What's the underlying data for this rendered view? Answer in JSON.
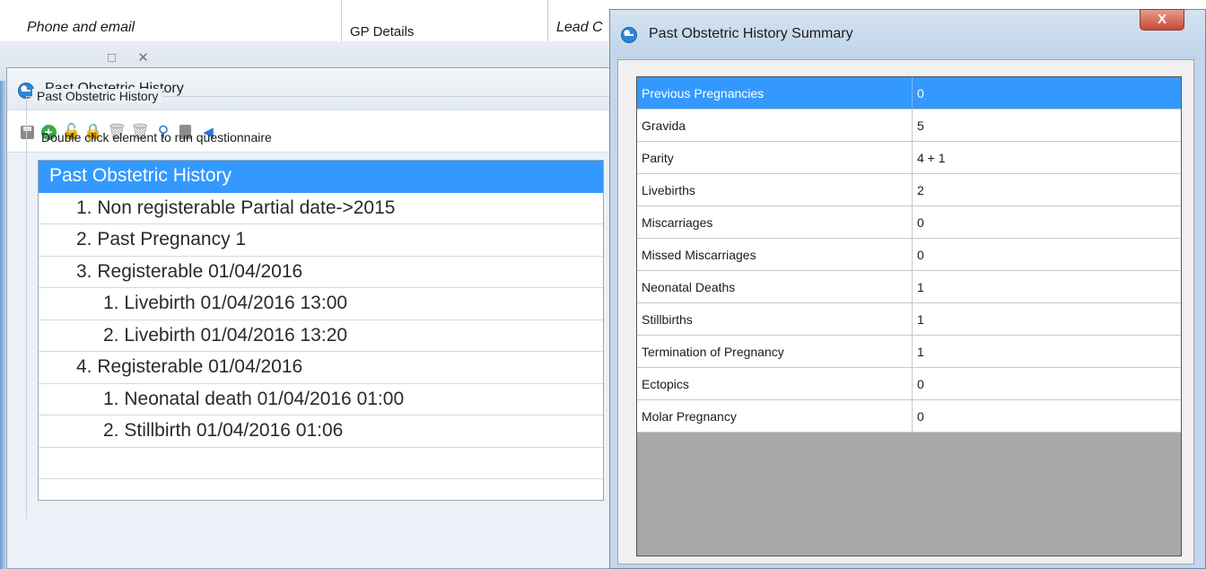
{
  "background": {
    "columns": [
      "Phone and email",
      "GP Details",
      "Lead C"
    ],
    "window_buttons": "□ ✕"
  },
  "obstetric_window": {
    "title": "Past Obstetric History",
    "toolbar": [
      "save-icon",
      "add-icon",
      "unlock-icon",
      "lock-icon",
      "delete-icon",
      "delete-all-icon",
      "zoom-out-icon",
      "calculator-icon",
      "back-arrow-icon"
    ],
    "group_label": "Past Obstetric History",
    "hint": "Double click element to run questionnaire",
    "tree": [
      {
        "label": "Past Obstetric History",
        "level": 0,
        "selected": true
      },
      {
        "label": "1. Non registerable Partial date->2015",
        "level": 1,
        "selected": false
      },
      {
        "label": "2. Past Pregnancy 1",
        "level": 1,
        "selected": false
      },
      {
        "label": "3. Registerable 01/04/2016",
        "level": 1,
        "selected": false
      },
      {
        "label": "1. Livebirth 01/04/2016 13:00",
        "level": 2,
        "selected": false
      },
      {
        "label": "2. Livebirth 01/04/2016 13:20",
        "level": 2,
        "selected": false
      },
      {
        "label": "4. Registerable 01/04/2016",
        "level": 1,
        "selected": false
      },
      {
        "label": "1. Neonatal death 01/04/2016 01:00",
        "level": 2,
        "selected": false
      },
      {
        "label": "2. Stillbirth 01/04/2016 01:06",
        "level": 2,
        "selected": false
      },
      {
        "label": "",
        "level": 0,
        "selected": false
      }
    ]
  },
  "summary_window": {
    "title": "Past Obstetric History Summary",
    "close_label": "X",
    "rows": [
      {
        "label": "Previous Pregnancies",
        "value": "0",
        "selected": true
      },
      {
        "label": "Gravida",
        "value": "5",
        "selected": false
      },
      {
        "label": "Parity",
        "value": "4 + 1",
        "selected": false
      },
      {
        "label": "Livebirths",
        "value": "2",
        "selected": false
      },
      {
        "label": "Miscarriages",
        "value": "0",
        "selected": false
      },
      {
        "label": "Missed Miscarriages",
        "value": "0",
        "selected": false
      },
      {
        "label": "Neonatal Deaths",
        "value": "1",
        "selected": false
      },
      {
        "label": "Stillbirths",
        "value": "1",
        "selected": false
      },
      {
        "label": "Termination of Pregnancy",
        "value": "1",
        "selected": false
      },
      {
        "label": "Ectopics",
        "value": "0",
        "selected": false
      },
      {
        "label": "Molar Pregnancy",
        "value": "0",
        "selected": false
      }
    ]
  },
  "colors": {
    "selection": "#3399ff",
    "grid_background": "#a8a8a8",
    "close_button": "#c74a34"
  }
}
